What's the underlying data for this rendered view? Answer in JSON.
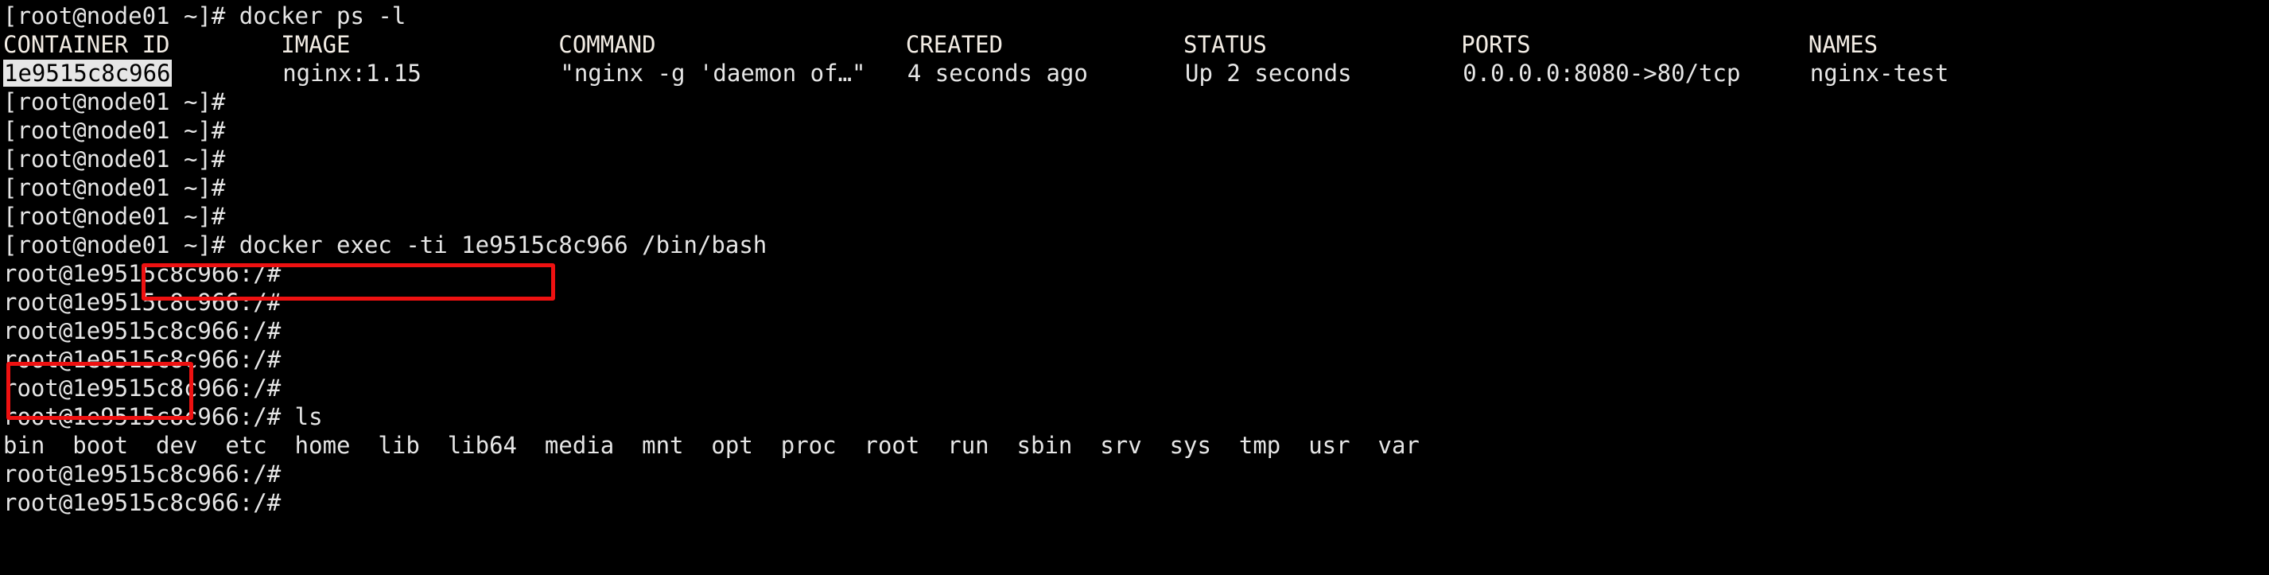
{
  "terminal": {
    "host_prompt": "[root@node01 ~]# ",
    "container_prompt": "root@1e9515c8c966:/# ",
    "colors": {
      "background": "#000000",
      "foreground": "#e6e6e6",
      "selection_bg": "#e6e6e6",
      "selection_fg": "#000000",
      "annotation": "#ee1111"
    },
    "lines": [
      {
        "kind": "prompt_command",
        "prompt": "[root@node01 ~]# ",
        "command": "docker ps -l"
      },
      {
        "kind": "table_header",
        "text": "CONTAINER ID        IMAGE               COMMAND                  CREATED             STATUS              PORTS                    NAMES"
      },
      {
        "kind": "table_row",
        "selected_text": "1e9515c8c966",
        "rest": "        nginx:1.15          \"nginx -g 'daemon of…\"   4 seconds ago       Up 2 seconds        0.0.0.0:8080->80/tcp     nginx-test"
      },
      {
        "kind": "prompt_only",
        "prompt": "[root@node01 ~]# ",
        "command": ""
      },
      {
        "kind": "prompt_only",
        "prompt": "[root@node01 ~]# ",
        "command": ""
      },
      {
        "kind": "prompt_only",
        "prompt": "[root@node01 ~]# ",
        "command": ""
      },
      {
        "kind": "prompt_only",
        "prompt": "[root@node01 ~]# ",
        "command": ""
      },
      {
        "kind": "prompt_only",
        "prompt": "[root@node01 ~]# ",
        "command": ""
      },
      {
        "kind": "prompt_command",
        "prompt": "[root@node01 ~]# ",
        "command": "docker exec -ti 1e9515c8c966 /bin/bash"
      },
      {
        "kind": "prompt_only",
        "prompt": "root@1e9515c8c966:/# ",
        "command": ""
      },
      {
        "kind": "prompt_only",
        "prompt": "root@1e9515c8c966:/# ",
        "command": ""
      },
      {
        "kind": "prompt_only",
        "prompt": "root@1e9515c8c966:/# ",
        "command": ""
      },
      {
        "kind": "prompt_only",
        "prompt": "root@1e9515c8c966:/# ",
        "command": ""
      },
      {
        "kind": "prompt_only",
        "prompt": "root@1e9515c8c966:/# ",
        "command": ""
      },
      {
        "kind": "prompt_command",
        "prompt": "root@1e9515c8c966:/# ",
        "command": "ls"
      },
      {
        "kind": "output",
        "text": "bin  boot  dev  etc  home  lib  lib64  media  mnt  opt  proc  root  run  sbin  srv  sys  tmp  usr  var"
      },
      {
        "kind": "prompt_only",
        "prompt": "root@1e9515c8c966:/# ",
        "command": ""
      },
      {
        "kind": "prompt_only",
        "prompt": "root@1e9515c8c966:/# ",
        "command": ""
      }
    ],
    "rendered": {
      "l0": "[root@node01 ~]# docker ps -l",
      "l1": "CONTAINER ID        IMAGE               COMMAND                  CREATED             STATUS              PORTS                    NAMES",
      "l2_id": "1e9515c8c966",
      "l2_rest": "        nginx:1.15          \"nginx -g 'daemon of…\"   4 seconds ago       Up 2 seconds        0.0.0.0:8080->80/tcp     nginx-test",
      "l3": "[root@node01 ~]# ",
      "l4": "[root@node01 ~]# ",
      "l5": "[root@node01 ~]# ",
      "l6": "[root@node01 ~]# ",
      "l7": "[root@node01 ~]# ",
      "l8": "[root@node01 ~]# docker exec -ti 1e9515c8c966 /bin/bash",
      "l9": "root@1e9515c8c966:/# ",
      "l10": "root@1e9515c8c966:/# ",
      "l11": "root@1e9515c8c966:/# ",
      "l12": "root@1e9515c8c966:/# ",
      "l13": "root@1e9515c8c966:/# ",
      "l14": "root@1e9515c8c966:/# ls",
      "l15": "bin  boot  dev  etc  home  lib  lib64  media  mnt  opt  proc  root  run  sbin  srv  sys  tmp  usr  var",
      "l16": "root@1e9515c8c966:/# ",
      "l17": "root@1e9515c8c966:/# "
    },
    "docker_ps": {
      "columns": [
        "CONTAINER ID",
        "IMAGE",
        "COMMAND",
        "CREATED",
        "STATUS",
        "PORTS",
        "NAMES"
      ],
      "rows": [
        {
          "container_id": "1e9515c8c966",
          "image": "nginx:1.15",
          "command": "\"nginx -g 'daemon of…\"",
          "created": "4 seconds ago",
          "status": "Up 2 seconds",
          "ports": "0.0.0.0:8080->80/tcp",
          "names": "nginx-test"
        }
      ]
    },
    "ls_output": [
      "bin",
      "boot",
      "dev",
      "etc",
      "home",
      "lib",
      "lib64",
      "media",
      "mnt",
      "opt",
      "proc",
      "root",
      "run",
      "sbin",
      "srv",
      "sys",
      "tmp",
      "usr",
      "var"
    ],
    "annotations": [
      {
        "name": "exec-command-highlight",
        "target": "docker exec -ti 1e9515c8c966 /bin/bash"
      },
      {
        "name": "container-prompt-highlight",
        "target": "root@1e9515c8c966:/#"
      }
    ]
  }
}
